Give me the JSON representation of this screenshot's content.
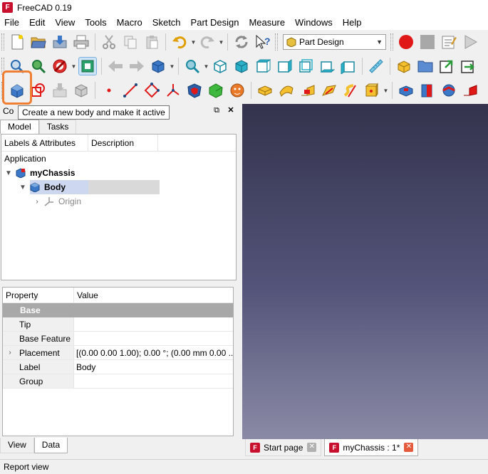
{
  "window": {
    "title": "FreeCAD 0.19",
    "logo": "F"
  },
  "menu": [
    "File",
    "Edit",
    "View",
    "Tools",
    "Macro",
    "Sketch",
    "Part Design",
    "Measure",
    "Windows",
    "Help"
  ],
  "workbench_select": {
    "value": "Part Design"
  },
  "tooltip": "Create a new body and make it active",
  "combo_view": {
    "title": "Combo View",
    "title_visible": "Co"
  },
  "top_tabs": [
    "Model",
    "Tasks"
  ],
  "tree": {
    "columns": [
      "Labels & Attributes",
      "Description"
    ],
    "root": "Application",
    "document": "myChassis",
    "body": "Body",
    "origin": "Origin"
  },
  "properties": {
    "columns": [
      "Property",
      "Value"
    ],
    "group": "Base",
    "rows": [
      {
        "name": "Tip",
        "value": "",
        "expandable": false
      },
      {
        "name": "Base Feature",
        "value": "",
        "expandable": false
      },
      {
        "name": "Placement",
        "value": "[(0.00 0.00 1.00); 0.00 °; (0.00 mm  0.00 ...",
        "expandable": true
      },
      {
        "name": "Label",
        "value": "Body",
        "expandable": false
      },
      {
        "name": "Group",
        "value": "",
        "expandable": false
      }
    ]
  },
  "bottom_tabs": [
    "View",
    "Data"
  ],
  "view_tabs": [
    {
      "label": "Start page"
    },
    {
      "label": "myChassis : 1*"
    }
  ],
  "report_view": "Report view",
  "colors": {
    "highlight": "#ef7f33",
    "viewport_top": "#33334d",
    "viewport_bottom": "#8a8aa6",
    "selection": "#cdd8f0"
  }
}
